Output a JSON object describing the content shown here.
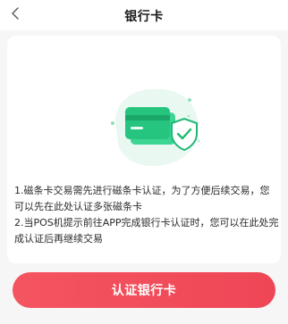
{
  "header": {
    "title": "银行卡"
  },
  "description": {
    "line1": "1.磁条卡交易需先进行磁条卡认证，为了方便后续交易，您可以先在此处认证多张磁条卡",
    "line2": "2.当POS机提示前往APP完成银行卡认证时，您可以在此处完成认证后再继续交易"
  },
  "action": {
    "button_label": "认证银行卡"
  },
  "colors": {
    "accent": "#f14b58",
    "illustration_green": "#2ecf8c",
    "background": "#f6f6f7"
  },
  "icons": {
    "back": "chevron-left-icon",
    "illustration": "bank-card-shield-icon"
  }
}
